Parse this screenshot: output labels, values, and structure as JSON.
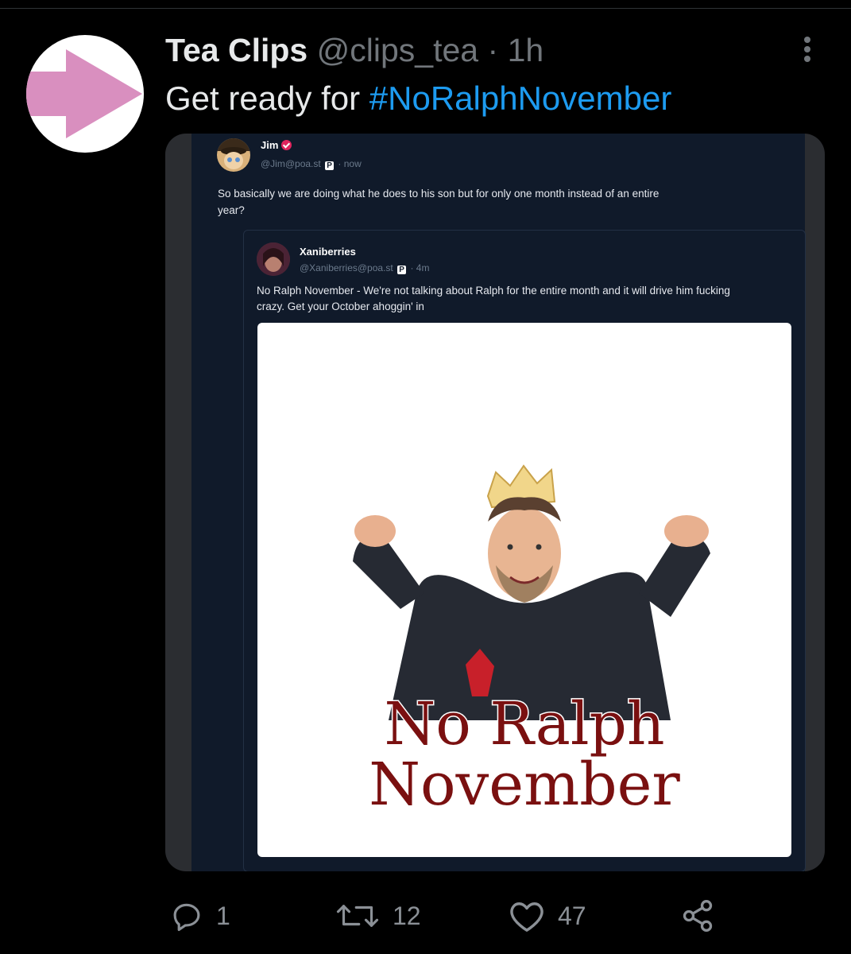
{
  "tweet": {
    "author_name": "Tea Clips",
    "handle": "@clips_tea",
    "separator": "·",
    "time": "1h",
    "text_prefix": "Get ready for ",
    "hashtag": "#NoRalphNovember"
  },
  "embedded": {
    "post": {
      "author": "Jim",
      "handle": "@Jim@poa.st",
      "time": "now",
      "text_line1": "So basically we are doing what he does to his son but for only one month instead of an entire",
      "text_line2": "year?"
    },
    "quoted": {
      "author": "Xaniberries",
      "handle": "@Xaniberries@poa.st",
      "time": "4m",
      "text_line1": "No Ralph November - We're not talking about Ralph for the entire month and it will drive him fucking",
      "text_line2": "crazy. Get your October ahoggin' in",
      "image_caption_line1": "No Ralph",
      "image_caption_line2": "November"
    },
    "platform_badge": "P",
    "meta_separator": "·"
  },
  "actions": {
    "reply_count": "1",
    "retweet_count": "12",
    "like_count": "47"
  },
  "icons": {
    "avatar": "pink-arrow-icon",
    "more": "more-options-icon",
    "reply": "reply-icon",
    "retweet": "retweet-icon",
    "like": "heart-icon",
    "share": "share-icon"
  },
  "colors": {
    "background": "#000000",
    "hashtag": "#1d9bf0",
    "muted": "#71767b",
    "arrow": "#d98fbf",
    "caption": "#7a1010"
  }
}
